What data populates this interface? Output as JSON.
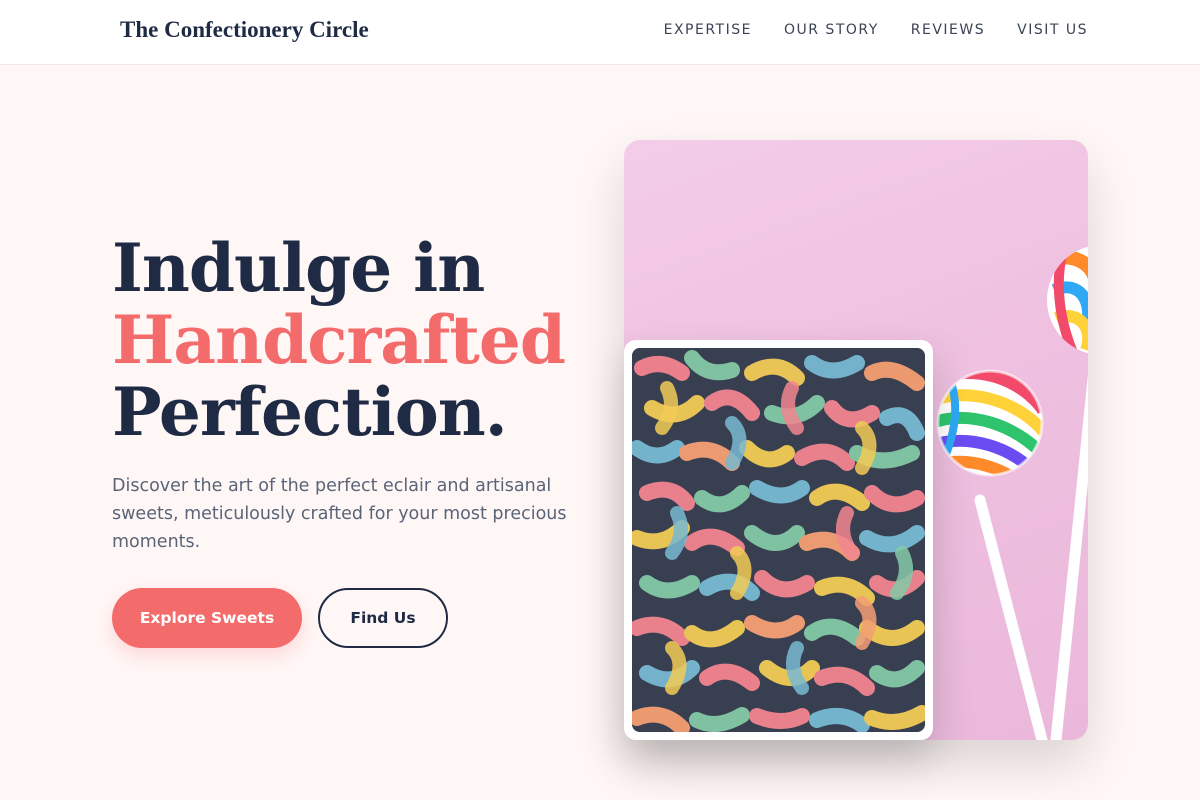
{
  "header": {
    "brand": "The Confectionery Circle",
    "nav": [
      "EXPERTISE",
      "OUR STORY",
      "REVIEWS",
      "VISIT US"
    ]
  },
  "hero": {
    "title_line1": "Indulge in",
    "title_line2": "Handcrafted",
    "title_line3": "Perfection.",
    "description": "Discover the art of the perfect eclair and artisanal sweets, meticulously crafted for your most precious moments.",
    "primary_button": "Explore Sweets",
    "secondary_button": "Find Us"
  },
  "colors": {
    "accent": "#f46b6b",
    "navy": "#1f2a44",
    "background": "#fff7f6",
    "pink_backdrop": "#efc0e0"
  },
  "images": {
    "main": "lollipops-on-pink-photo",
    "inset": "sour-gummy-worms-photo"
  }
}
